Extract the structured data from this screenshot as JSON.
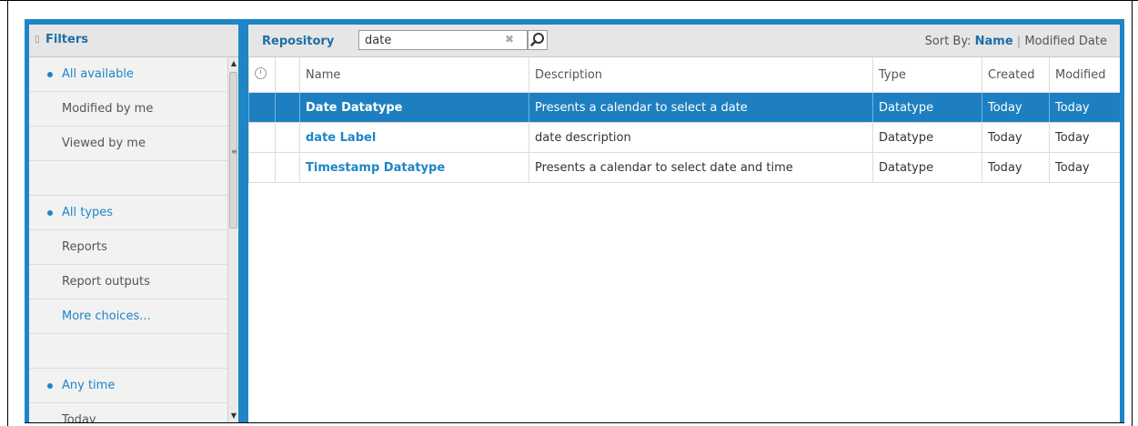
{
  "sidebar": {
    "title": "Filters",
    "toggle_icon": "▯",
    "groups": [
      {
        "items": [
          {
            "label": "All available",
            "selected": true
          },
          {
            "label": "Modified by me",
            "selected": false
          },
          {
            "label": "Viewed by me",
            "selected": false
          }
        ]
      },
      {
        "items": [
          {
            "label": "All types",
            "selected": true
          },
          {
            "label": "Reports",
            "selected": false
          },
          {
            "label": "Report outputs",
            "selected": false
          },
          {
            "label": "More choices...",
            "selected": false,
            "link": true
          }
        ]
      },
      {
        "items": [
          {
            "label": "Any time",
            "selected": true
          },
          {
            "label": "Today",
            "selected": false
          }
        ]
      }
    ]
  },
  "toolbar": {
    "repository_label": "Repository",
    "search_value": "date",
    "clear_icon": "✖",
    "sort_by_label": "Sort By:",
    "sort_name": "Name",
    "sort_separator": "|",
    "sort_modified": "Modified Date"
  },
  "table": {
    "columns": [
      "",
      "",
      "Name",
      "Description",
      "Type",
      "Created",
      "Modified"
    ],
    "rows": [
      {
        "name": "Date Datatype",
        "description": "Presents a calendar to select a date",
        "type": "Datatype",
        "created": "Today",
        "modified": "Today",
        "selected": true
      },
      {
        "name": "date Label",
        "description": "date description",
        "type": "Datatype",
        "created": "Today",
        "modified": "Today",
        "selected": false
      },
      {
        "name": "Timestamp Datatype",
        "description": "Presents a calendar to select date and time",
        "type": "Datatype",
        "created": "Today",
        "modified": "Today",
        "selected": false
      }
    ]
  },
  "colors": {
    "accent": "#1e85c7",
    "selected_row": "#1e7fc0",
    "frame": "#1e85c7"
  }
}
